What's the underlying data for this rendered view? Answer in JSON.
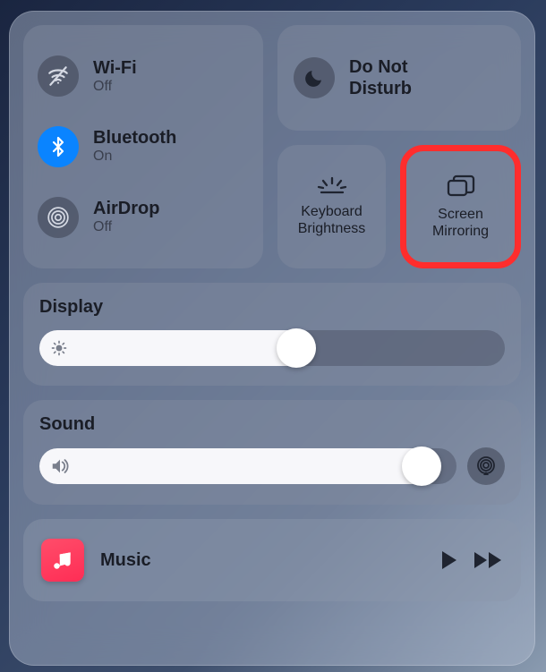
{
  "connectivity": {
    "wifi": {
      "label": "Wi-Fi",
      "status": "Off",
      "active": false
    },
    "bluetooth": {
      "label": "Bluetooth",
      "status": "On",
      "active": true
    },
    "airdrop": {
      "label": "AirDrop",
      "status": "Off",
      "active": false
    }
  },
  "dnd": {
    "label": "Do Not Disturb",
    "active": false
  },
  "keyboard_brightness": {
    "label": "Keyboard Brightness"
  },
  "screen_mirroring": {
    "label": "Screen Mirroring"
  },
  "display": {
    "title": "Display",
    "value_percent": 59
  },
  "sound": {
    "title": "Sound",
    "value_percent": 96
  },
  "now_playing": {
    "app": "Music"
  },
  "highlighted_control": "screen_mirroring"
}
